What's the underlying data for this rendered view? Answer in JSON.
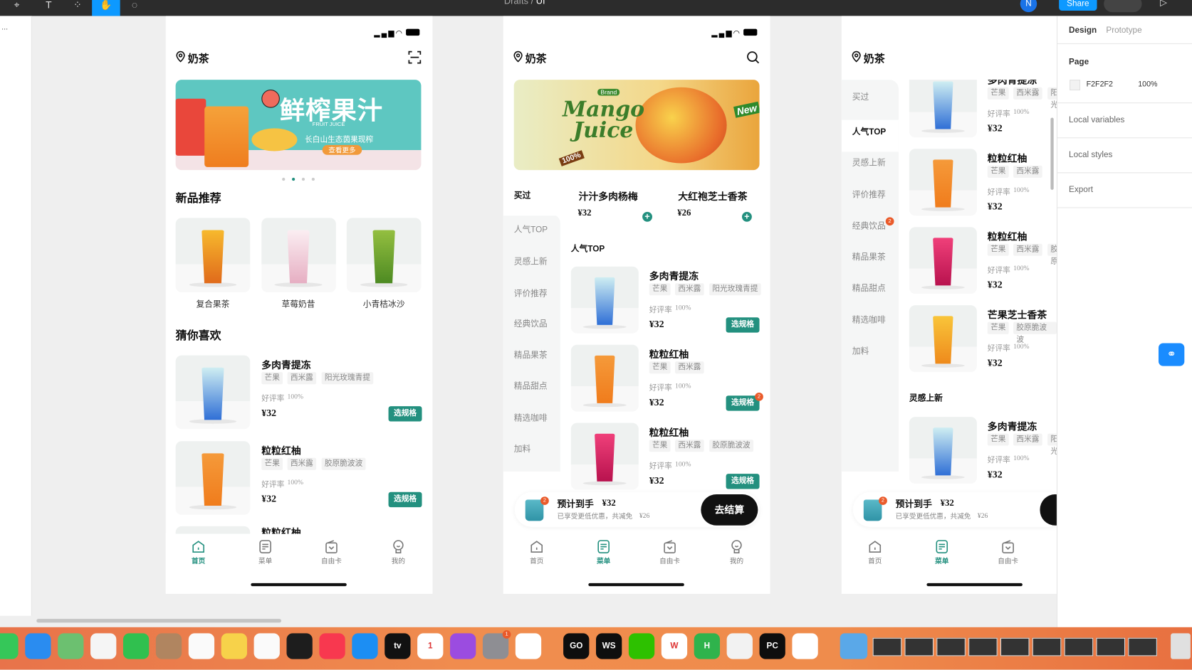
{
  "figma": {
    "breadcrumb": "Drafts",
    "separator": "/",
    "file": "UI",
    "avatar": "N",
    "share": "Share",
    "left_panel_label": "..."
  },
  "right_panel": {
    "tabs": [
      "Design",
      "Prototype"
    ],
    "page_label": "Page",
    "page_color": "F2F2F2",
    "page_opacity": "100%",
    "sections": [
      "Local variables",
      "Local styles",
      "Export"
    ]
  },
  "theme": {
    "accent": "#23907f",
    "badge": "#ea5a2a",
    "dark": "#111111"
  },
  "app": {
    "location": "奶茶",
    "tabs": [
      {
        "label": "首页",
        "icon": "home-icon"
      },
      {
        "label": "菜单",
        "icon": "menu-icon"
      },
      {
        "label": "自由卡",
        "icon": "card-icon"
      },
      {
        "label": "我的",
        "icon": "profile-icon"
      }
    ]
  },
  "phone1": {
    "banner": {
      "title": "鲜榨果汁",
      "subtitle_en": "FRUIT JUICE",
      "tagline": "长白山生态茵果现榨",
      "cta": "查看更多",
      "active_dot": 2,
      "dots": 4
    },
    "new_title": "新品推荐",
    "new_products": [
      {
        "name": "复合果茶",
        "colors": [
          "#f7b92d",
          "#e06a1b"
        ]
      },
      {
        "name": "草莓奶昔",
        "colors": [
          "#fbeef2",
          "#e6aec2"
        ]
      },
      {
        "name": "小青桔冰沙",
        "colors": [
          "#94bf40",
          "#4d8a22"
        ]
      }
    ],
    "guess_title": "猜你喜欢",
    "items": [
      {
        "name": "多肉青提冻",
        "tags": [
          "芒果",
          "西米露",
          "阳光玫瑰青提"
        ],
        "rating_label": "好评率",
        "rating": "100%",
        "price": "¥32",
        "button": "选规格",
        "colors": [
          "#cfeef2",
          "#2f6fd6"
        ]
      },
      {
        "name": "粒粒红柚",
        "tags": [
          "芒果",
          "西米露",
          "胶原脆波波"
        ],
        "rating_label": "好评率",
        "rating": "100%",
        "price": "¥32",
        "button": "选规格",
        "colors": [
          "#f59a3a",
          "#f07c1c"
        ]
      },
      {
        "name": "粒粒红柚"
      }
    ],
    "active_tab": 0
  },
  "phone2": {
    "banner": {
      "brand": "Brand",
      "title1": "Mango",
      "title2": "Juice",
      "badge": "New",
      "percent": "100%"
    },
    "sidebar": [
      "买过",
      "人气TOP",
      "灵感上新",
      "评价推荐",
      "经典饮品",
      "精品果茶",
      "精品甜点",
      "精选咖啡",
      "加料"
    ],
    "bought": [
      {
        "name": "汁汁多肉杨梅",
        "price": "¥32"
      },
      {
        "name": "大红袍芝士香茶",
        "price": "¥26"
      }
    ],
    "section": "人气TOP",
    "items": [
      {
        "name": "多肉青提冻",
        "tags": [
          "芒果",
          "西米露",
          "阳光玫瑰青提"
        ],
        "rating_label": "好评率",
        "rating": "100%",
        "price": "¥32",
        "button": "选规格",
        "colors": [
          "#cfeef2",
          "#2f6fd6"
        ]
      },
      {
        "name": "粒粒红柚",
        "tags": [
          "芒果",
          "西米露"
        ],
        "rating_label": "好评率",
        "rating": "100%",
        "price": "¥32",
        "button": "选规格",
        "badge": "2",
        "colors": [
          "#f59a3a",
          "#f07c1c"
        ]
      },
      {
        "name": "粒粒红柚",
        "tags": [
          "芒果",
          "西米露",
          "胶原脆波波"
        ],
        "rating_label": "好评率",
        "rating": "100%",
        "price": "¥32",
        "button": "选规格",
        "colors": [
          "#f0407a",
          "#b8124e"
        ]
      }
    ],
    "cart": {
      "badge": "2",
      "title": "预计到手",
      "price": "¥32",
      "subtitle": "已享受更低优惠，共减免",
      "discount": "¥26",
      "button": "去结算"
    },
    "active_tab": 1
  },
  "phone3": {
    "sidebar": [
      "买过",
      "人气TOP",
      "灵感上新",
      "评价推荐",
      "经典饮品",
      "精品果茶",
      "精品甜点",
      "精选咖啡",
      "加料"
    ],
    "sidebar_badge": {
      "index": 4,
      "count": "2"
    },
    "items": [
      {
        "name": "多肉青提冻",
        "tags": [
          "芒果",
          "西米露",
          "阳光"
        ],
        "rating_label": "好评率",
        "rating": "100%",
        "price": "¥32",
        "colors": [
          "#cfeef2",
          "#2f6fd6"
        ]
      },
      {
        "name": "粒粒红柚",
        "tags": [
          "芒果",
          "西米露"
        ],
        "rating_label": "好评率",
        "rating": "100%",
        "price": "¥32",
        "colors": [
          "#f59a3a",
          "#f07c1c"
        ]
      },
      {
        "name": "粒粒红柚",
        "tags": [
          "芒果",
          "西米露",
          "胶原"
        ],
        "rating_label": "好评率",
        "rating": "100%",
        "price": "¥32",
        "colors": [
          "#f0407a",
          "#b8124e"
        ]
      },
      {
        "name": "芒果芝士香茶",
        "tags": [
          "芒果",
          "胶原脆波波"
        ],
        "rating_label": "好评率",
        "rating": "100%",
        "price": "¥32",
        "colors": [
          "#f9c53a",
          "#ee8a1c"
        ]
      }
    ],
    "section": "灵感上新",
    "section_items": [
      {
        "name": "多肉青提冻",
        "tags": [
          "芒果",
          "西米露",
          "阳光"
        ],
        "rating_label": "好评率",
        "rating": "100%",
        "price": "¥32",
        "colors": [
          "#cfeef2",
          "#2f6fd6"
        ]
      }
    ],
    "cart": {
      "badge": "2",
      "title": "预计到手",
      "price": "¥32",
      "subtitle": "已享受更低优惠，共减免",
      "discount": "¥26"
    },
    "active_tab": 1
  },
  "dock": [
    {
      "app": "messages",
      "color": "#35c759"
    },
    {
      "app": "mail",
      "color": "#2a8cf0"
    },
    {
      "app": "maps",
      "color": "#6cc070"
    },
    {
      "app": "photos",
      "color": "#f5f5f5"
    },
    {
      "app": "facetime",
      "color": "#30c04f"
    },
    {
      "app": "contacts",
      "color": "#b08560"
    },
    {
      "app": "reminders",
      "color": "#fafafa"
    },
    {
      "app": "notes",
      "color": "#f7d24a"
    },
    {
      "app": "freeform",
      "color": "#fafafa"
    },
    {
      "app": "terminal",
      "color": "#1d1d1d"
    },
    {
      "app": "music",
      "color": "#f8384f"
    },
    {
      "app": "app-store",
      "color": "#1c8ef3"
    },
    {
      "app": "tv",
      "color": "#111111",
      "label": "tv"
    },
    {
      "app": "calendar",
      "color": "#ffffff",
      "label": "1"
    },
    {
      "app": "podcasts",
      "color": "#9b4ce0"
    },
    {
      "app": "settings",
      "color": "#8e8e93",
      "badge": "1"
    },
    {
      "app": "chrome",
      "color": "#ffffff"
    },
    {
      "app": "goland",
      "color": "#0e0e0e",
      "label": "GO"
    },
    {
      "app": "webstorm",
      "color": "#0e0e0e",
      "label": "WS"
    },
    {
      "app": "wechat",
      "color": "#2dc100"
    },
    {
      "app": "wps",
      "color": "#ffffff",
      "label": "W"
    },
    {
      "app": "hbuilder",
      "color": "#2fb34c",
      "label": "H"
    },
    {
      "app": "chat",
      "color": "#f2f2f2"
    },
    {
      "app": "pycharm",
      "color": "#0e0e0e",
      "label": "PC"
    },
    {
      "app": "baidu-netdisk",
      "color": "#ffffff"
    }
  ]
}
